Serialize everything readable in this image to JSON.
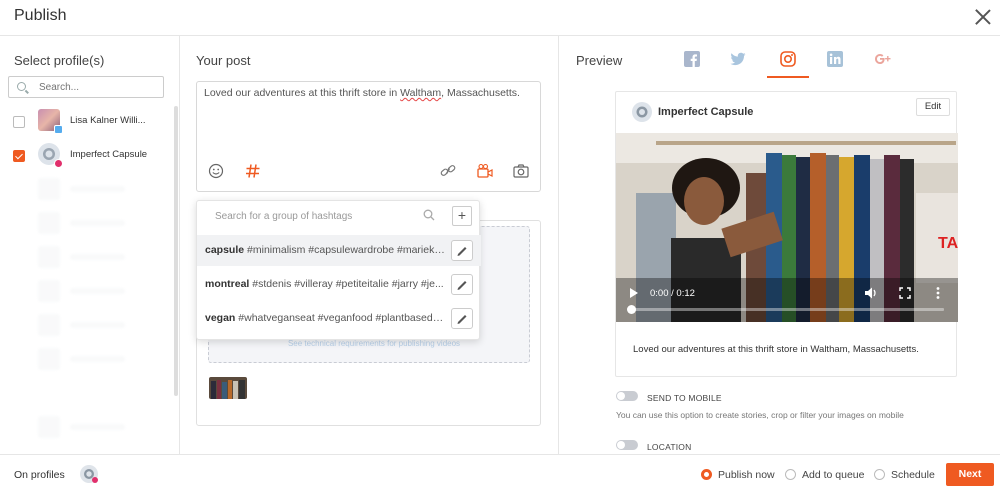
{
  "header": {
    "title": "Publish"
  },
  "profiles": {
    "title": "Select profile(s)",
    "search_placeholder": "Search...",
    "items": [
      {
        "name": "Lisa Kalner Willi...",
        "network": "twitter",
        "checked": false
      },
      {
        "name": "Imperfect Capsule",
        "network": "instagram",
        "checked": true
      }
    ]
  },
  "post": {
    "title": "Your post",
    "text_before": "Loved our adventures at this thrift store in ",
    "text_underlined": "Waltham",
    "text_after": ", Massachusetts.",
    "tools": [
      "emoji-icon",
      "hashtag-icon",
      "link-icon",
      "video-icon",
      "camera-icon"
    ],
    "drop_link_text": "See technical requirements for publishing videos"
  },
  "hashtag_popup": {
    "search_placeholder": "Search for a group of hashtags",
    "add_label": "+",
    "groups": [
      {
        "name": "capsule",
        "tags": "#minimalism #capsulewardrobe #marieko..."
      },
      {
        "name": "montreal",
        "tags": "#stdenis #villeray #petiteitalie #jarry #je..."
      },
      {
        "name": "vegan",
        "tags": "#whatveganseat #veganfood #plantbased #..."
      }
    ]
  },
  "preview": {
    "title": "Preview",
    "networks": [
      "facebook-icon",
      "twitter-icon",
      "instagram-icon",
      "linkedin-icon",
      "google-plus-icon"
    ],
    "active_network": "instagram-icon",
    "account_name": "Imperfect Capsule",
    "edit_label": "Edit",
    "video_time": "0:00 / 0:12",
    "caption": "Loved our adventures at this thrift store in Waltham, Massachusetts.",
    "send_to_mobile_label": "SEND TO MOBILE",
    "send_to_mobile_hint": "You can use this option to create stories, crop or filter your images on mobile",
    "location_label": "LOCATION"
  },
  "footer": {
    "on_profiles_label": "On profiles",
    "options": [
      {
        "label": "Publish now",
        "selected": true
      },
      {
        "label": "Add to queue",
        "selected": false
      },
      {
        "label": "Schedule",
        "selected": false
      }
    ],
    "next_label": "Next"
  },
  "colors": {
    "accent": "#ef5a21",
    "facebook": "#3b5998",
    "twitter": "#55acee",
    "linkedin": "#0077b5",
    "google_plus": "#dd4b39"
  }
}
